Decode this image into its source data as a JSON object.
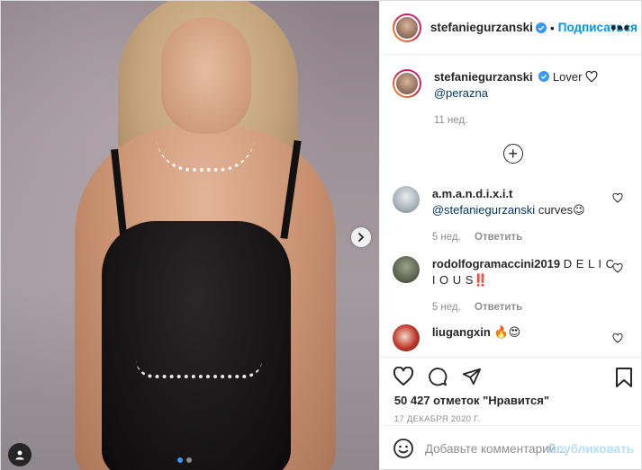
{
  "header": {
    "username": "stefaniegurzanski",
    "separator": "•",
    "follow_label": "Подписаться",
    "more_label": "•••"
  },
  "caption": {
    "username": "stefaniegurzanski",
    "text": "Lover",
    "mention": "@perazna",
    "time": "11 нед."
  },
  "load_more_label": "+",
  "comments": [
    {
      "username": "a.m.a.n.d.i.x.i.t",
      "mention": "@stefaniegurzanski",
      "text": "curves",
      "emoji": "😉",
      "time": "5 нед.",
      "reply": "Ответить"
    },
    {
      "username": "rodolfogramaccini2019",
      "text": "D E L I C I O U S‼️",
      "time": "5 нед.",
      "reply": "Ответить"
    },
    {
      "username": "liugangxin",
      "text": "🔥😍"
    }
  ],
  "likes": "50 427 отметок \"Нравится\"",
  "date": "17 ДЕКАБРЯ 2020 Г.",
  "add_comment": {
    "placeholder": "Добавьте комментарий...",
    "publish_label": "Опубликовать"
  },
  "colors": {
    "link": "#0095f6",
    "carousel_active_dot": "#3897f0",
    "publish_disabled": "#b2dffc"
  }
}
